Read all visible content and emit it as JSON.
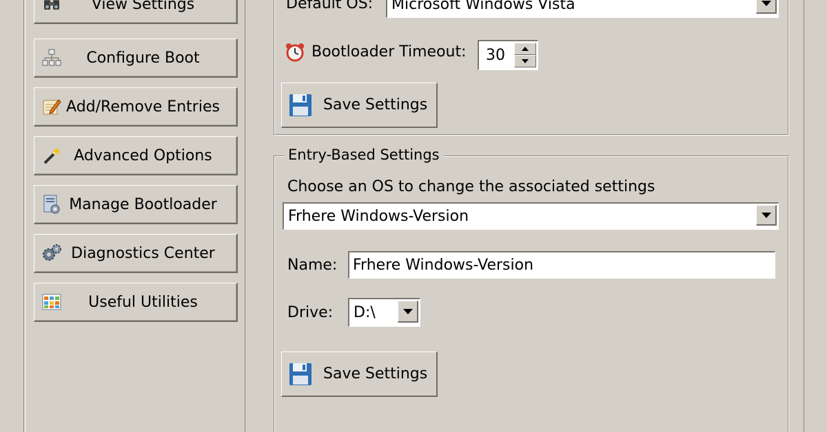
{
  "sidebar": {
    "items": [
      {
        "label": "View Settings",
        "icon": "binoculars-icon"
      },
      {
        "label": "Configure Boot",
        "icon": "sitemap-icon"
      },
      {
        "label": "Add/Remove Entries",
        "icon": "edit-entry-icon"
      },
      {
        "label": "Advanced Options",
        "icon": "magic-wand-icon"
      },
      {
        "label": "Manage Bootloader",
        "icon": "bootloader-icon"
      },
      {
        "label": "Diagnostics Center",
        "icon": "gears-icon"
      },
      {
        "label": "Useful Utilities",
        "icon": "grid-icon"
      }
    ]
  },
  "global_settings": {
    "default_os_label": "Default OS:",
    "default_os_value": "Microsoft Windows Vista",
    "timeout_label": "Bootloader Timeout:",
    "timeout_value": "30",
    "save_label": "Save Settings"
  },
  "entry_settings": {
    "group_title": "Entry-Based Settings",
    "choose_label": "Choose an OS to change the associated settings",
    "os_selected": "Frhere Windows-Version",
    "name_label": "Name:",
    "name_value": "Frhere Windows-Version",
    "drive_label": "Drive:",
    "drive_value": "D:\\",
    "save_label": "Save Settings"
  },
  "colors": {
    "face": "#d4d0c8",
    "shadow": "#6e6c66",
    "highlight": "#ffffff"
  }
}
